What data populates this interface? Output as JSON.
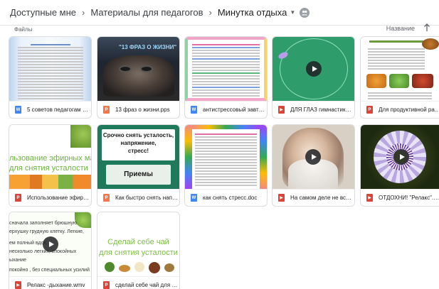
{
  "breadcrumb": {
    "root": "Доступные мне",
    "parent": "Материалы для педагогов",
    "current": "Минутка отдыха"
  },
  "toolbar": {
    "files_label": "Файлы",
    "sort_label": "Название"
  },
  "thumbs": {
    "t2_title": "\"13 ФРАЗ О ЖИЗНИ\"",
    "t7_line1": "Срочно снять усталость,",
    "t7_line2": "напряжение,",
    "t7_line3": "стресс!",
    "t7_button": "Приемы",
    "t6_line1": "льзование эфирных масел",
    "t6_line2": "для снятия усталости",
    "t11_line1": "сначала заполняет брюшную",
    "t11_line2": "ерхушку грудную клетку. Легкие,",
    "t11_line3": "ем полный вдох,",
    "t11_line4": "несколько легких, спокойных",
    "t11_line5": "ыхание",
    "t11_line6": "покойно , без специальных усилий",
    "t12_line1": "Сделай себе чай",
    "t12_line2": "для снятия усталости"
  },
  "files": [
    {
      "name": "5 советов педагогам по у...",
      "type": "word"
    },
    {
      "name": "13 фраз о жизни.pps",
      "type": "ppt"
    },
    {
      "name": "антистрессовый завтрак...",
      "type": "word"
    },
    {
      "name": "ДЛЯ ГЛАЗ гимнастика по...",
      "type": "video"
    },
    {
      "name": "Для продуктивной работ...",
      "type": "pdf"
    },
    {
      "name": "Использование эфирных...",
      "type": "pdf"
    },
    {
      "name": "Как быстро снять напря...",
      "type": "ppt"
    },
    {
      "name": "как снять стресс.doc",
      "type": "word"
    },
    {
      "name": "На самом деле не все та...",
      "type": "video"
    },
    {
      "name": "ОТДОХНИ! \"Релакс\".mpg",
      "type": "video"
    },
    {
      "name": "Релакс -дыхание.wmv",
      "type": "video"
    },
    {
      "name": "сделай себе чай для сн...",
      "type": "pdf"
    }
  ],
  "colors": {
    "word": "#4285f4",
    "ppt": "#f4764a",
    "video": "#db4437",
    "accent_green": "#2e9d6b"
  }
}
